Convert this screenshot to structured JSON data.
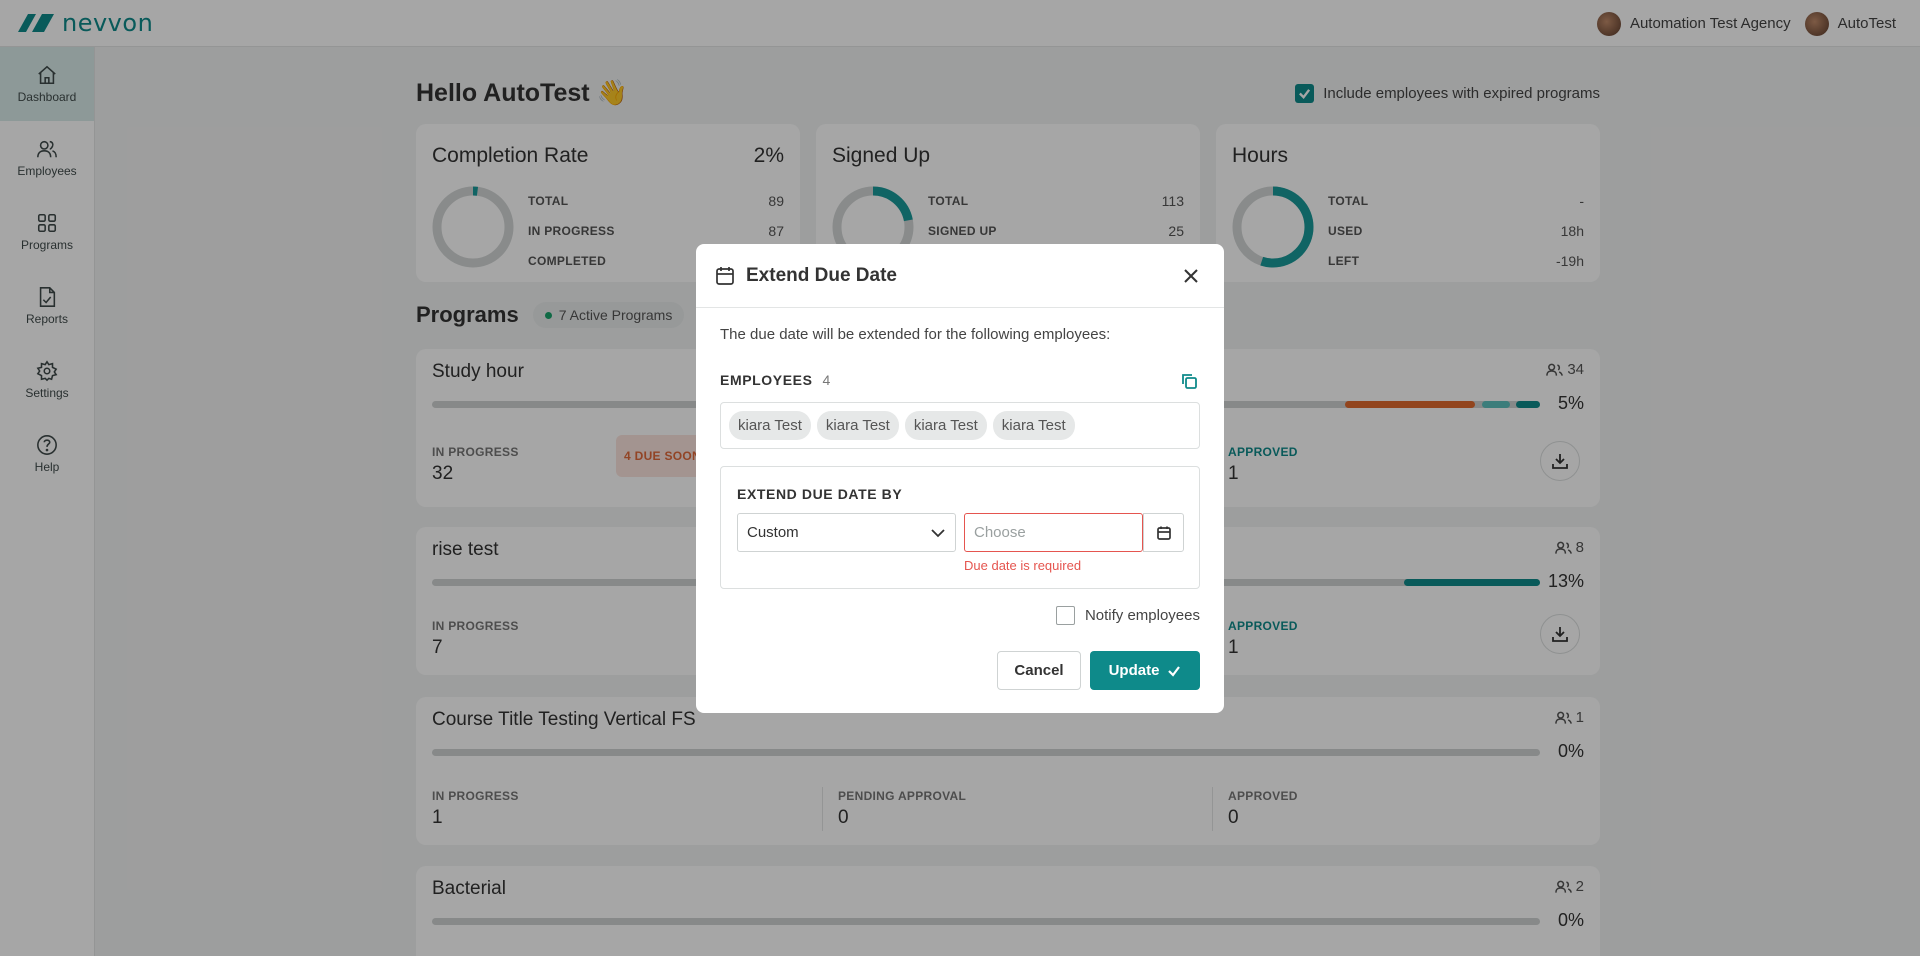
{
  "app": {
    "logo_text": "nevvon",
    "org_name": "Automation Test Agency",
    "user_name": "AutoTest",
    "brand_color": "#0e8a8a"
  },
  "sidebar": {
    "items": [
      {
        "label": "Dashboard",
        "icon": "home-icon",
        "active": true
      },
      {
        "label": "Employees",
        "icon": "users-icon"
      },
      {
        "label": "Programs",
        "icon": "grid-icon"
      },
      {
        "label": "Reports",
        "icon": "report-icon"
      },
      {
        "label": "Settings",
        "icon": "gear-icon"
      },
      {
        "label": "Help",
        "icon": "help-icon"
      }
    ]
  },
  "dashboard": {
    "greeting": "Hello AutoTest 👋",
    "expired_label": "Include employees with expired programs",
    "expired_checked": true,
    "stats": [
      {
        "title": "Completion Rate",
        "pct": "2%",
        "fill": 0.02,
        "rows": [
          {
            "k": "TOTAL",
            "v": "89"
          },
          {
            "k": "IN PROGRESS",
            "v": "87"
          },
          {
            "k": "COMPLETED",
            "v": ""
          }
        ]
      },
      {
        "title": "Signed Up",
        "pct": "",
        "fill": 0.22,
        "rows": [
          {
            "k": "TOTAL",
            "v": "113"
          },
          {
            "k": "SIGNED UP",
            "v": "25"
          }
        ]
      },
      {
        "title": "Hours",
        "pct": "",
        "fill": 0.55,
        "rows": [
          {
            "k": "TOTAL",
            "v": "-"
          },
          {
            "k": "USED",
            "v": "18h"
          },
          {
            "k": "LEFT",
            "v": "-19h"
          }
        ]
      }
    ],
    "programs_title": "Programs",
    "active_programs": "7 Active Programs",
    "programs": [
      {
        "title": "Study hour",
        "count": "34",
        "pct": "5%",
        "in_progress_label": "IN PROGRESS",
        "in_progress": "32",
        "due_soon": "4 DUE SOON",
        "approved_label": "APPROVED",
        "approved": "1"
      },
      {
        "title": "rise test",
        "count": "8",
        "pct": "13%",
        "in_progress_label": "IN PROGRESS",
        "in_progress": "7",
        "approved_label": "APPROVED",
        "approved": "1"
      },
      {
        "title": "Course Title Testing Vertical FS",
        "count": "1",
        "pct": "0%",
        "in_progress_label": "IN PROGRESS",
        "in_progress": "1",
        "pending_label": "PENDING APPROVAL",
        "pending": "0",
        "approved_label": "APPROVED",
        "approved": "0"
      },
      {
        "title": "Bacterial",
        "count": "2",
        "pct": "0%"
      }
    ]
  },
  "modal": {
    "title": "Extend Due Date",
    "description": "The due date will be extended for the following employees:",
    "employees_label": "EMPLOYEES",
    "employees_count": "4",
    "employees": [
      "kiara Test",
      "kiara Test",
      "kiara Test",
      "kiara Test"
    ],
    "extend_label": "EXTEND DUE DATE BY",
    "extend_option": "Custom",
    "date_placeholder": "Choose",
    "date_value": "",
    "error": "Due date is required",
    "notify_label": "Notify employees",
    "notify_checked": false,
    "cancel_label": "Cancel",
    "update_label": "Update",
    "error_color": "#e5554f"
  }
}
